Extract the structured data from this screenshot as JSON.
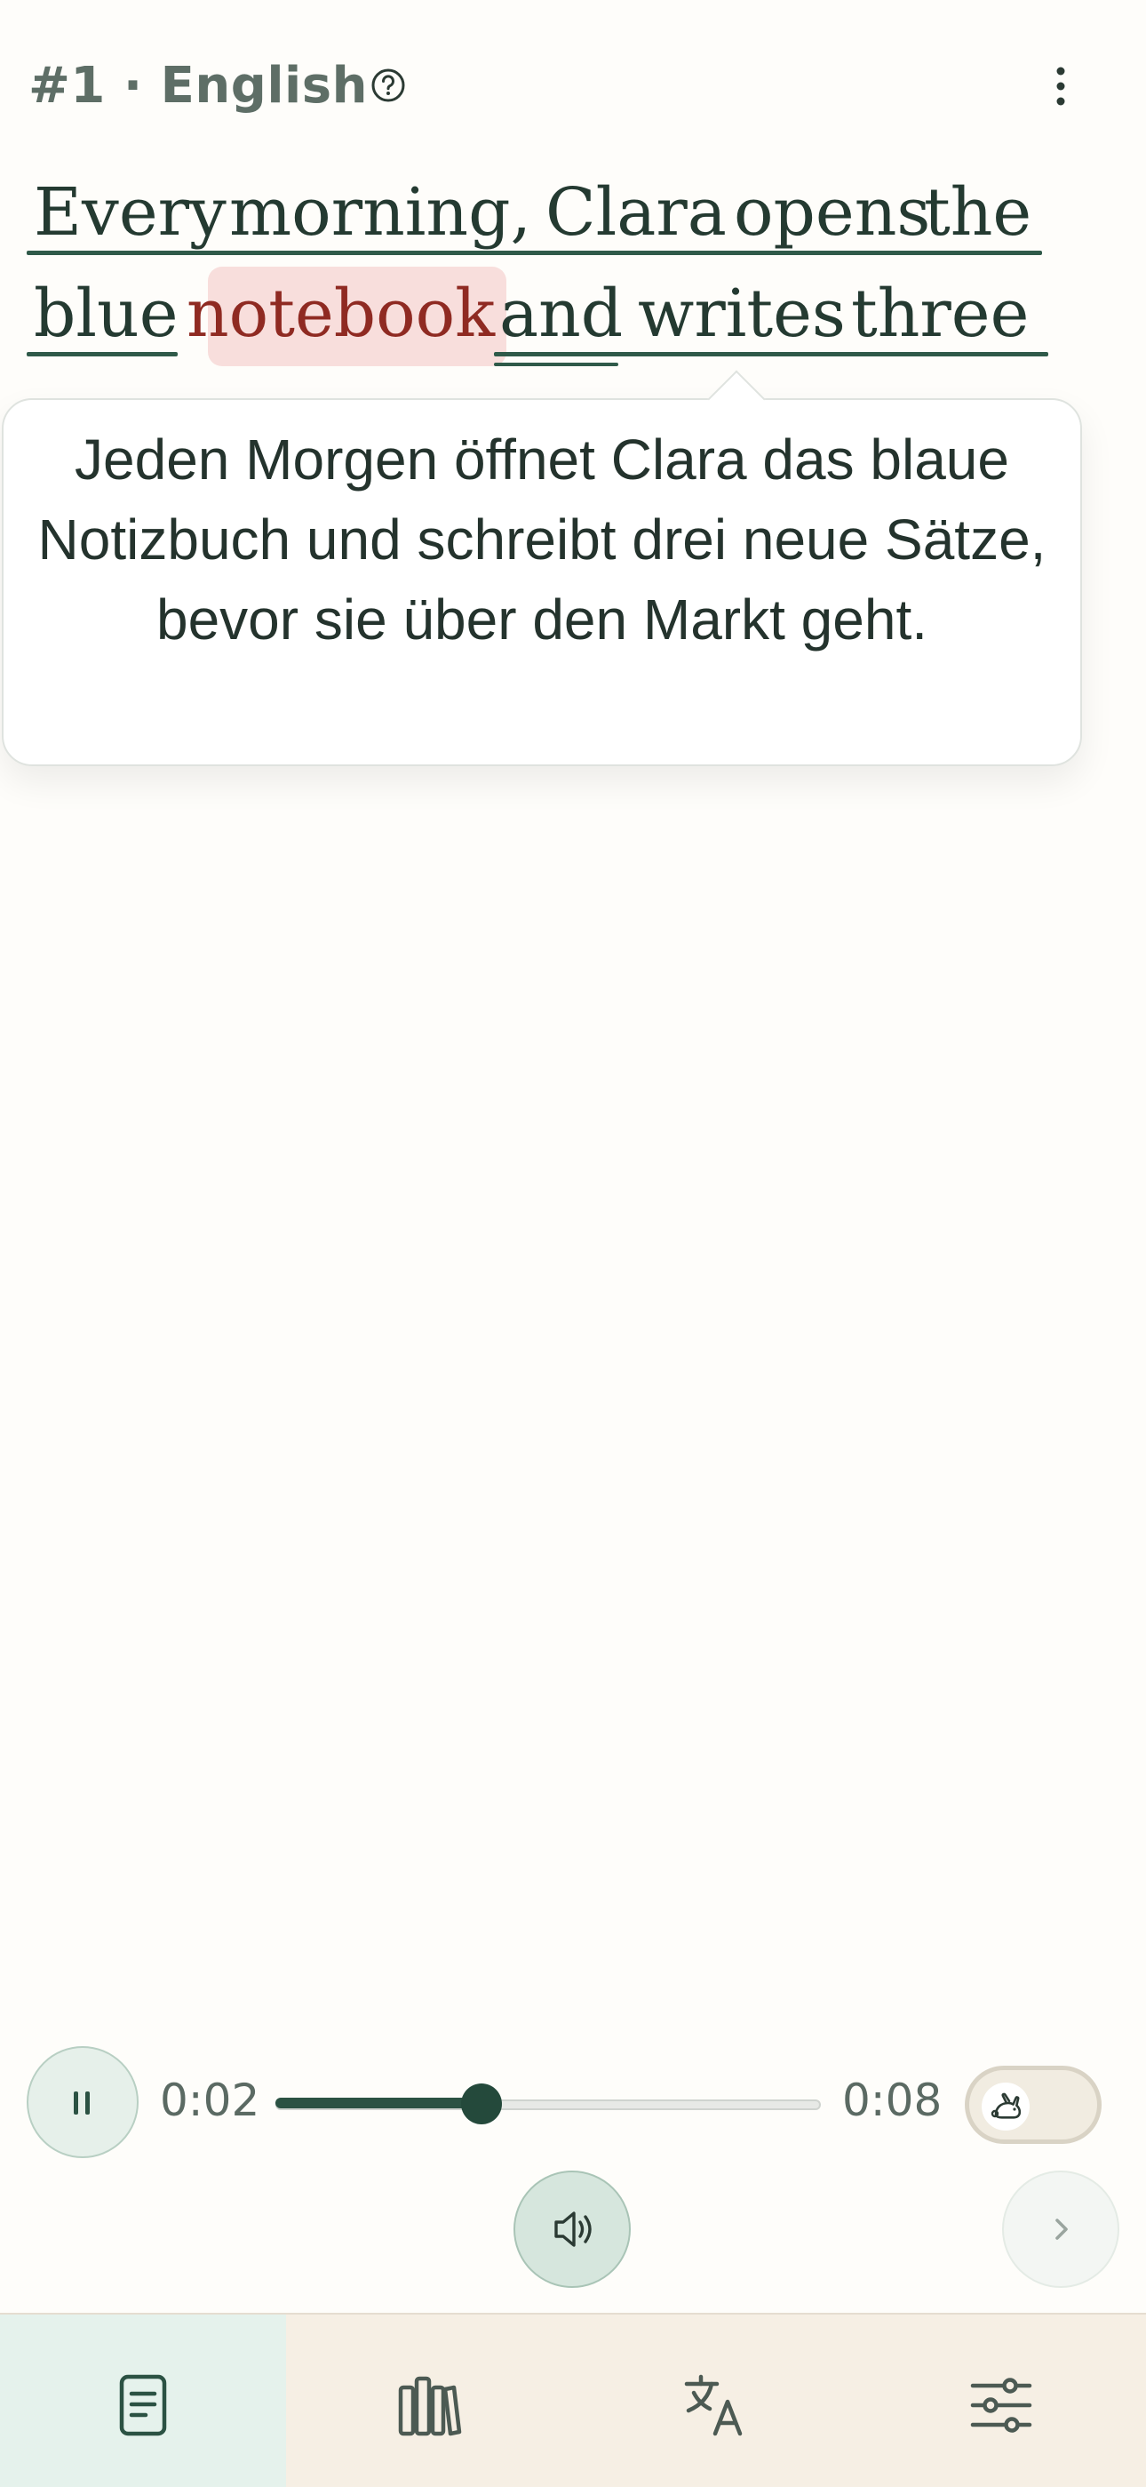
{
  "header": {
    "title": "#1 · English",
    "help_icon": "help-circle-icon",
    "more_icon": "more-vertical-icon"
  },
  "passage": {
    "line1": [
      "Every",
      "morning,",
      "Clara",
      "opens",
      "the"
    ],
    "line2": [
      "blue",
      "notebook",
      "and",
      "writes",
      "three"
    ],
    "highlighted_word": "notebook"
  },
  "tooltip": {
    "translation": "Jeden Morgen öffnet Clara das blaue Notizbuch und schreibt drei neue Sätze, bevor sie über den Markt geht."
  },
  "player": {
    "current_time": "0:02",
    "total_time": "0:08",
    "progress": 0.38,
    "pause_icon": "pause-icon",
    "speed_icon": "rabbit-icon",
    "speaker_icon": "speaker-icon",
    "next_icon": "chevron-right-icon"
  },
  "nav": {
    "items": [
      {
        "icon": "reader-icon",
        "active": true
      },
      {
        "icon": "library-icon",
        "active": false
      },
      {
        "icon": "translate-icon",
        "active": false
      },
      {
        "icon": "settings-sliders-icon",
        "active": false
      }
    ]
  },
  "colors": {
    "background": "#fefdfa",
    "accent": "#24493b",
    "highlight_bg": "#f8dedc",
    "highlight_text": "#8f2a22",
    "nav_bg": "#f6efe4",
    "nav_active_bg": "#e5f2ec"
  }
}
